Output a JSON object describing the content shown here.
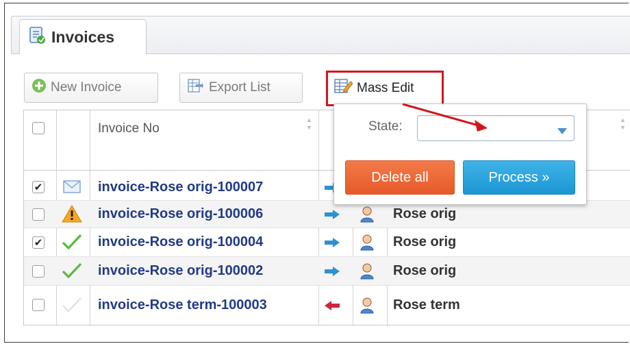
{
  "tab": {
    "label": "Invoices"
  },
  "toolbar": {
    "new_invoice": "New Invoice",
    "export_list": "Export List",
    "mass_edit": "Mass Edit"
  },
  "table": {
    "header": {
      "invoice_no": "Invoice No"
    },
    "rows": [
      {
        "checked": true,
        "status_icon": "envelope-icon",
        "invoice": "invoice-Rose orig-100007",
        "direction": "outgoing-arrow-icon",
        "account": "Rose orig"
      },
      {
        "checked": false,
        "status_icon": "warning-icon",
        "invoice": "invoice-Rose orig-100006",
        "direction": "outgoing-arrow-icon",
        "account": "Rose orig"
      },
      {
        "checked": true,
        "status_icon": "checkmark-icon",
        "invoice": "invoice-Rose orig-100004",
        "direction": "outgoing-arrow-icon",
        "account": "Rose orig"
      },
      {
        "checked": false,
        "status_icon": "checkmark-icon",
        "invoice": "invoice-Rose orig-100002",
        "direction": "outgoing-arrow-icon",
        "account": "Rose orig"
      },
      {
        "checked": false,
        "status_icon": "faded-checkmark-icon",
        "invoice": "invoice-Rose term-100003",
        "direction": "incoming-arrow-icon",
        "account": "Rose term"
      }
    ]
  },
  "mass_edit_popup": {
    "state_label": "State:",
    "state_value": "",
    "delete_all": "Delete all",
    "process": "Process »"
  },
  "colors": {
    "highlight": "#d4151b",
    "link": "#213a86",
    "delete_button": "#e9653a",
    "process_button": "#2aa5df"
  }
}
